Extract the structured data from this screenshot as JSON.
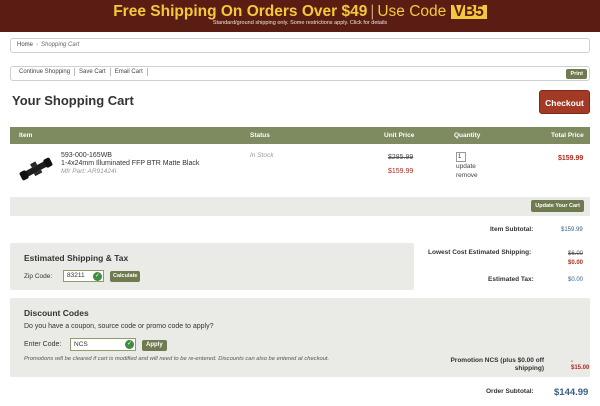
{
  "banner": {
    "headline": "Free Shipping On Orders Over $49",
    "separator": "|",
    "use_code_text": "Use Code",
    "code": "VB5",
    "subtext": "Standard/ground shipping only. Some restrictions apply. Click for details"
  },
  "breadcrumb": {
    "home": "Home",
    "separator": "›",
    "current": "Shopping Cart"
  },
  "actions": {
    "continue_shopping": "Continue Shopping",
    "save_cart": "Save Cart",
    "email_cart": "Email Cart",
    "print": "Print"
  },
  "page": {
    "title": "Your Shopping Cart",
    "checkout": "Checkout"
  },
  "table": {
    "headers": {
      "item": "Item",
      "status": "Status",
      "unit_price": "Unit Price",
      "quantity": "Quantity",
      "total_price": "Total Price"
    },
    "rows": [
      {
        "sku": "593-000-165WB",
        "name": "1-4x24mm Illuminated FFP BTR Matte Black",
        "mfr_part": "Mfr Part: AR91424I",
        "status": "In Stock",
        "original_price": "$285.99",
        "sale_price": "$159.99",
        "quantity": "1",
        "update_link": "update",
        "remove_link": "remove",
        "total": "$159.99",
        "image_icon": "rifle-scope-icon"
      }
    ],
    "update_cart": "Update Your Cart"
  },
  "summary": {
    "item_subtotal_label": "Item Subtotal:",
    "item_subtotal": "$159.99",
    "lowest_cost_shipping_label": "Lowest Cost Estimated Shipping:",
    "lowest_cost_shipping_original": "$6.00",
    "lowest_cost_shipping": "$0.00",
    "estimated_tax_label": "Estimated Tax:",
    "estimated_tax": "$0.00",
    "promotion_label": "Promotion NCS (plus $0.00 off shipping)",
    "promotion_value": "- $15.00",
    "order_subtotal_label": "Order Subtotal:",
    "order_subtotal": "$144.99"
  },
  "shipping": {
    "title": "Estimated Shipping & Tax",
    "zip_label": "Zip Code:",
    "zip_value": "83211",
    "calculate": "Calculate"
  },
  "discount": {
    "title": "Discount Codes",
    "question": "Do you have a coupon, source code or promo code to apply?",
    "code_label": "Enter Code:",
    "code_value": "NCS",
    "apply": "Apply",
    "note": "Promotions will be cleared if cart is modified and will need to be re-entered. Discounts can also be entered at checkout."
  },
  "colors": {
    "banner_bg": "#5a1d14",
    "banner_text": "#f3c93c",
    "header_bg": "#7e8a60",
    "button_green": "#6f7a50",
    "checkout_red": "#a33a26",
    "price_red": "#b02a1e",
    "value_blue": "#3a5f8a",
    "panel_gray": "#eaeae6"
  }
}
